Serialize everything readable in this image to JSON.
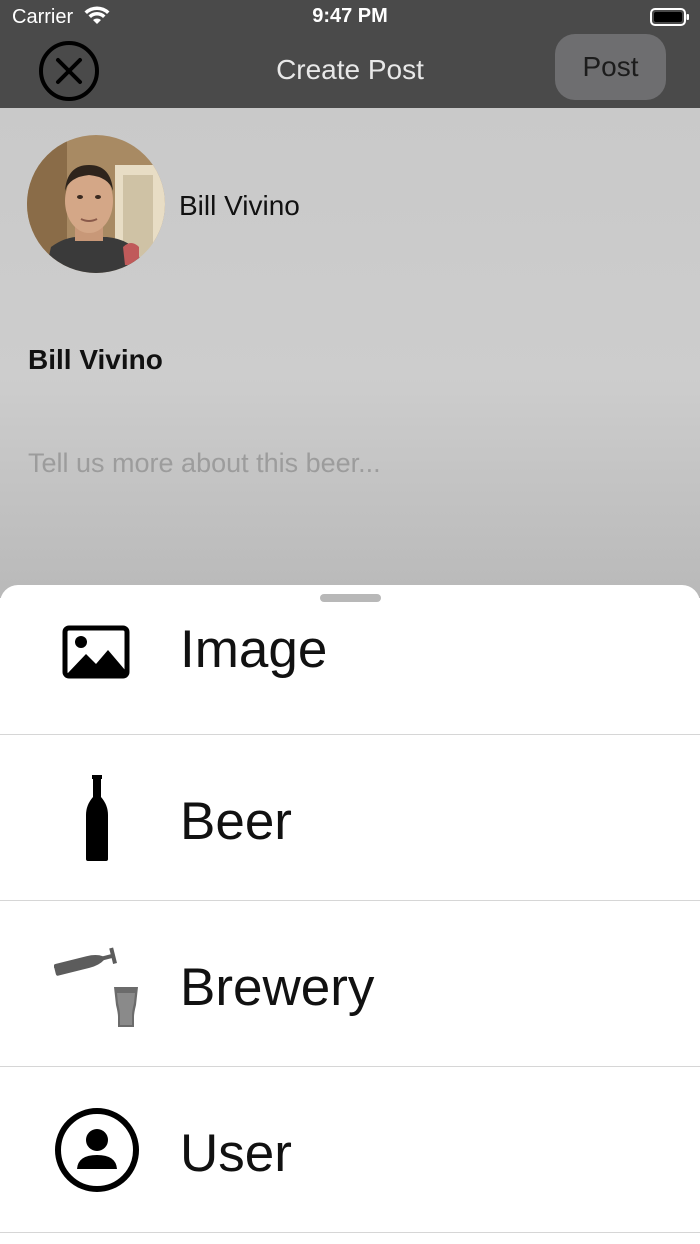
{
  "status_bar": {
    "carrier": "Carrier",
    "time": "9:47 PM",
    "icons": [
      "wifi-icon",
      "battery-icon"
    ]
  },
  "nav": {
    "title": "Create Post",
    "post_label": "Post",
    "close_icon": "close-circle-icon"
  },
  "composer": {
    "avatar_name": "Bill Vivino",
    "author_name": "Bill Vivino",
    "placeholder": "Tell us more about this beer..."
  },
  "sheet": {
    "items": [
      {
        "label": "Image",
        "icon": "image-icon"
      },
      {
        "label": "Beer",
        "icon": "beer-bottle-icon"
      },
      {
        "label": "Brewery",
        "icon": "brewery-icon"
      },
      {
        "label": "User",
        "icon": "user-circle-icon"
      }
    ]
  },
  "colors": {
    "nav_background": "#4a4a4a",
    "dim_overlay": "#c9c9c9",
    "sheet_background": "#ffffff",
    "divider": "#d6d6d6"
  }
}
